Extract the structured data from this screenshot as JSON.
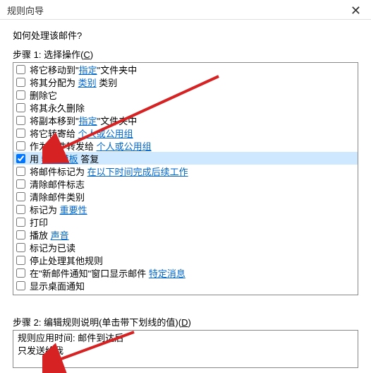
{
  "window": {
    "title": "规则向导",
    "close_symbol": "✕"
  },
  "main": {
    "question": "如何处理该邮件?",
    "step1_label_prefix": "步骤 1: 选择操作(",
    "step1_access": "C",
    "step1_label_suffix": ")",
    "items": [
      {
        "checked": false,
        "parts": [
          {
            "t": "将它移动到\"",
            "l": false
          },
          {
            "t": "指定",
            "l": true
          },
          {
            "t": "\"文件夹中",
            "l": false
          }
        ]
      },
      {
        "checked": false,
        "parts": [
          {
            "t": "将其分配为 ",
            "l": false
          },
          {
            "t": "类别",
            "l": true
          },
          {
            "t": " 类别",
            "l": false
          }
        ]
      },
      {
        "checked": false,
        "parts": [
          {
            "t": "删除它",
            "l": false
          }
        ]
      },
      {
        "checked": false,
        "parts": [
          {
            "t": "将其永久删除",
            "l": false
          }
        ]
      },
      {
        "checked": false,
        "parts": [
          {
            "t": "将副本移到\"",
            "l": false
          },
          {
            "t": "指定",
            "l": true
          },
          {
            "t": "\"文件夹中",
            "l": false
          }
        ]
      },
      {
        "checked": false,
        "parts": [
          {
            "t": "将它转寄给 ",
            "l": false
          },
          {
            "t": "个人或公用组",
            "l": true
          }
        ]
      },
      {
        "checked": false,
        "parts": [
          {
            "t": "作为附件转发给 ",
            "l": false
          },
          {
            "t": "个人或公用组",
            "l": true
          }
        ]
      },
      {
        "checked": true,
        "selected": true,
        "parts": [
          {
            "t": "用 ",
            "l": false
          },
          {
            "t": "特定模板",
            "l": true
          },
          {
            "t": " 答复",
            "l": false
          }
        ]
      },
      {
        "checked": false,
        "parts": [
          {
            "t": "将邮件标记为 ",
            "l": false
          },
          {
            "t": "在以下时间完成后续工作",
            "l": true
          }
        ]
      },
      {
        "checked": false,
        "parts": [
          {
            "t": "清除邮件标志",
            "l": false
          }
        ]
      },
      {
        "checked": false,
        "parts": [
          {
            "t": "清除邮件类别",
            "l": false
          }
        ]
      },
      {
        "checked": false,
        "parts": [
          {
            "t": "标记为 ",
            "l": false
          },
          {
            "t": "重要性",
            "l": true
          }
        ]
      },
      {
        "checked": false,
        "parts": [
          {
            "t": "打印",
            "l": false
          }
        ]
      },
      {
        "checked": false,
        "parts": [
          {
            "t": "播放 ",
            "l": false
          },
          {
            "t": "声音",
            "l": true
          }
        ]
      },
      {
        "checked": false,
        "parts": [
          {
            "t": "标记为已读",
            "l": false
          }
        ]
      },
      {
        "checked": false,
        "parts": [
          {
            "t": "停止处理其他规则",
            "l": false
          }
        ]
      },
      {
        "checked": false,
        "parts": [
          {
            "t": "在\"新邮件通知\"窗口显示邮件 ",
            "l": false
          },
          {
            "t": "特定消息",
            "l": true
          }
        ]
      },
      {
        "checked": false,
        "parts": [
          {
            "t": "显示桌面通知",
            "l": false
          }
        ]
      }
    ],
    "step2_label_prefix": "步骤 2: 编辑规则说明(单击带下划线的值)(",
    "step2_access": "D",
    "step2_label_suffix": ")",
    "desc": {
      "line1": "规则应用时间: 邮件到达后",
      "line2": "只发送给我"
    }
  },
  "arrow_color": "#d62222"
}
